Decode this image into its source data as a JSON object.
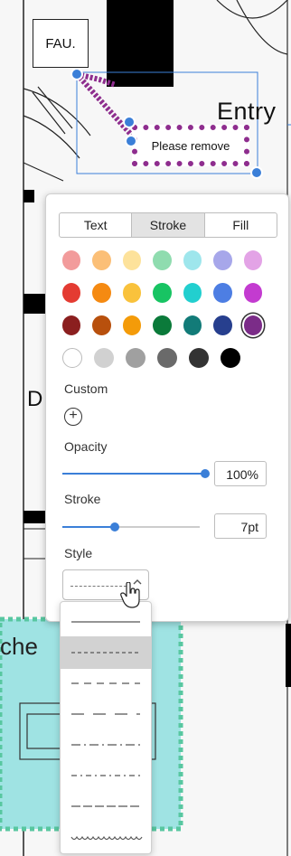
{
  "canvas": {
    "fau_label": "FAU.",
    "entry_label": "Entry",
    "shape_text": "Please remove",
    "d_label": "D",
    "che_label": "che"
  },
  "panel": {
    "tabs": [
      {
        "label": "Text",
        "active": false
      },
      {
        "label": "Stroke",
        "active": true
      },
      {
        "label": "Fill",
        "active": false
      }
    ],
    "swatch_rows": [
      [
        "#f29b9b",
        "#fbbf77",
        "#fde29b",
        "#8fdcaf",
        "#9ee6ec",
        "#a7a7ea",
        "#e3a3e6"
      ],
      [
        "#e43b32",
        "#f58a12",
        "#f9c23c",
        "#18c463",
        "#22cfcf",
        "#4d7ee3",
        "#c33bd0"
      ],
      [
        "#8b1f1f",
        "#b8500d",
        "#f49b09",
        "#0b7a3a",
        "#127b78",
        "#273f8e",
        "#7b2c88"
      ],
      [
        "#ffffff",
        "#d1d1d1",
        "#a0a0a0",
        "#6a6a6a",
        "#333333",
        "#000000"
      ]
    ],
    "selected_color": "#7b2c88",
    "custom_label": "Custom",
    "custom_add_icon": "+",
    "opacity_label": "Opacity",
    "opacity_value": "100%",
    "opacity_fraction": 1.0,
    "stroke_label": "Stroke",
    "stroke_value": "7pt",
    "stroke_fraction": 0.38,
    "style_label": "Style",
    "style_selected": "dashed",
    "style_chevron_icon": "chevron-up-icon"
  },
  "style_dropdown": {
    "options": [
      {
        "name": "solid"
      },
      {
        "name": "dashed",
        "selected": true
      },
      {
        "name": "long-dashed"
      },
      {
        "name": "dash-long"
      },
      {
        "name": "dash-dot"
      },
      {
        "name": "dash-dot-dash"
      },
      {
        "name": "dash-double"
      },
      {
        "name": "wavy"
      }
    ]
  },
  "accent_color": "#3b7fd8"
}
